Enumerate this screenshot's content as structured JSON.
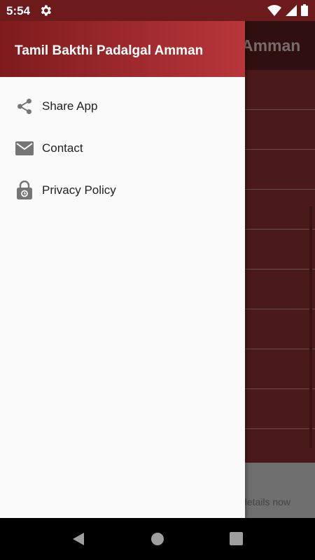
{
  "status_bar": {
    "time": "5:54"
  },
  "app": {
    "title_partial": "Amman",
    "banner_partial": "details now",
    "rows": 9
  },
  "drawer": {
    "title": "Tamil Bakthi Padalgal Amman",
    "items": [
      {
        "label": "Share App",
        "icon": "share-icon"
      },
      {
        "label": "Contact",
        "icon": "mail-icon"
      },
      {
        "label": "Privacy Policy",
        "icon": "lock-icon"
      }
    ]
  },
  "colors": {
    "drawer_header_start": "#7e1b1d",
    "drawer_header_end": "#b8363a",
    "status_bar": "#6d1a1c"
  }
}
